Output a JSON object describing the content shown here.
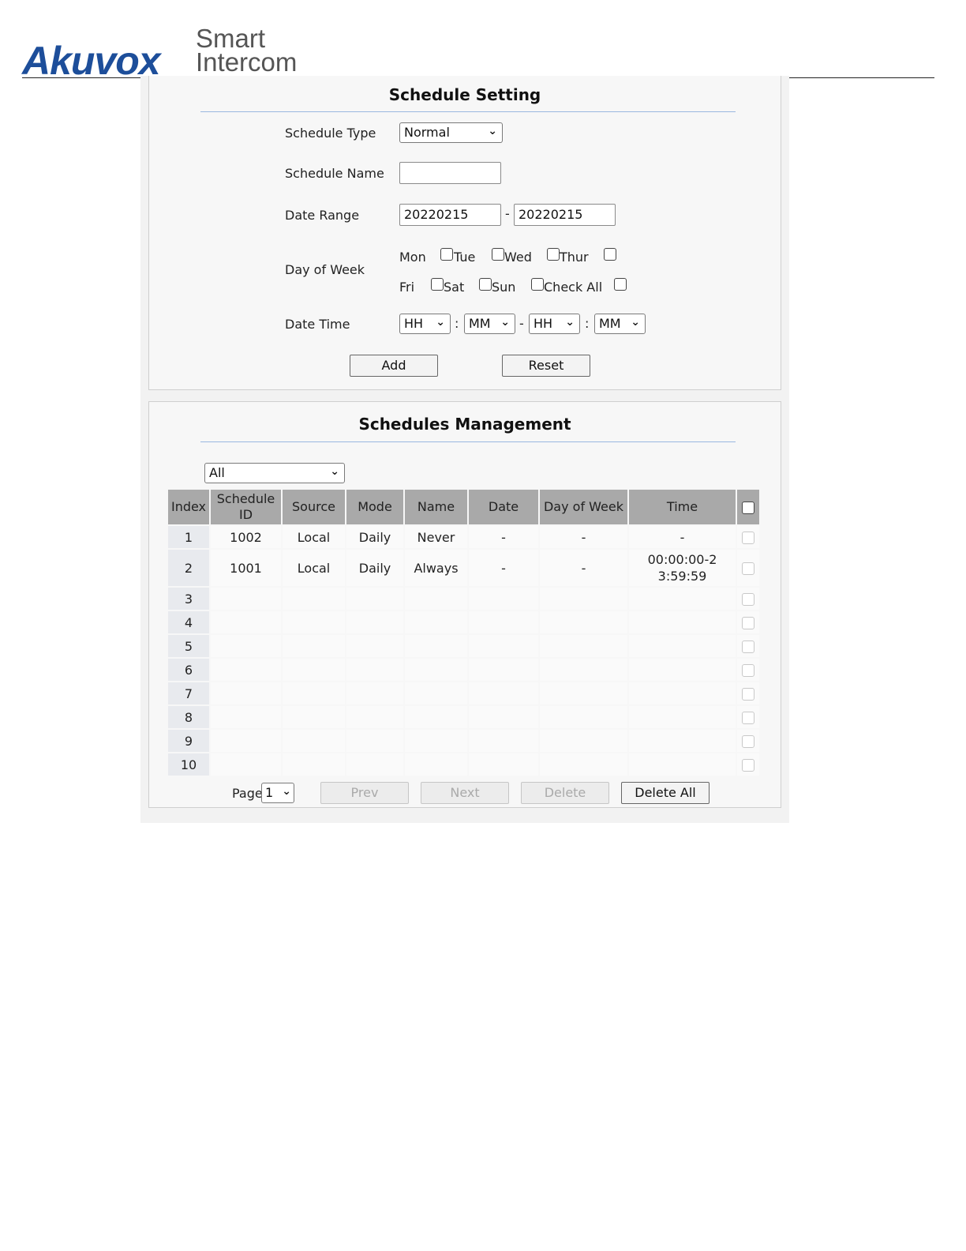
{
  "header": {
    "brand": "Akuvox",
    "tagline_line1": "Smart",
    "tagline_line2": "Intercom"
  },
  "schedule_setting": {
    "title": "Schedule Setting",
    "schedule_type": {
      "label": "Schedule Type",
      "value": "Normal"
    },
    "schedule_name": {
      "label": "Schedule Name",
      "value": ""
    },
    "date_range": {
      "label": "Date Range",
      "start": "20220215",
      "separator": "-",
      "end": "20220215"
    },
    "day_of_week": {
      "label": "Day of Week",
      "days": [
        "Mon",
        "Tue",
        "Wed",
        "Thur",
        "Fri",
        "Sat",
        "Sun",
        "Check All"
      ]
    },
    "date_time": {
      "label": "Date Time",
      "start_hour": "HH",
      "start_minute": "MM",
      "end_hour": "HH",
      "end_minute": "MM",
      "colon": ":",
      "dash": "-"
    },
    "add_label": "Add",
    "reset_label": "Reset"
  },
  "schedules_management": {
    "title": "Schedules Management",
    "filter_value": "All",
    "columns": [
      "Index",
      "Schedule ID",
      "Source",
      "Mode",
      "Name",
      "Date",
      "Day of Week",
      "Time"
    ],
    "rows": [
      {
        "index": "1",
        "schedule_id": "1002",
        "source": "Local",
        "mode": "Daily",
        "name": "Never",
        "date": "-",
        "day_of_week": "-",
        "time": "-"
      },
      {
        "index": "2",
        "schedule_id": "1001",
        "source": "Local",
        "mode": "Daily",
        "name": "Always",
        "date": "-",
        "day_of_week": "-",
        "time": "00:00:00-23:59:59"
      },
      {
        "index": "3",
        "schedule_id": "",
        "source": "",
        "mode": "",
        "name": "",
        "date": "",
        "day_of_week": "",
        "time": ""
      },
      {
        "index": "4",
        "schedule_id": "",
        "source": "",
        "mode": "",
        "name": "",
        "date": "",
        "day_of_week": "",
        "time": ""
      },
      {
        "index": "5",
        "schedule_id": "",
        "source": "",
        "mode": "",
        "name": "",
        "date": "",
        "day_of_week": "",
        "time": ""
      },
      {
        "index": "6",
        "schedule_id": "",
        "source": "",
        "mode": "",
        "name": "",
        "date": "",
        "day_of_week": "",
        "time": ""
      },
      {
        "index": "7",
        "schedule_id": "",
        "source": "",
        "mode": "",
        "name": "",
        "date": "",
        "day_of_week": "",
        "time": ""
      },
      {
        "index": "8",
        "schedule_id": "",
        "source": "",
        "mode": "",
        "name": "",
        "date": "",
        "day_of_week": "",
        "time": ""
      },
      {
        "index": "9",
        "schedule_id": "",
        "source": "",
        "mode": "",
        "name": "",
        "date": "",
        "day_of_week": "",
        "time": ""
      },
      {
        "index": "10",
        "schedule_id": "",
        "source": "",
        "mode": "",
        "name": "",
        "date": "",
        "day_of_week": "",
        "time": ""
      }
    ],
    "pagination": {
      "page_label": "Page",
      "page_value": "1",
      "prev_label": "Prev",
      "next_label": "Next",
      "delete_label": "Delete",
      "delete_all_label": "Delete All"
    }
  }
}
